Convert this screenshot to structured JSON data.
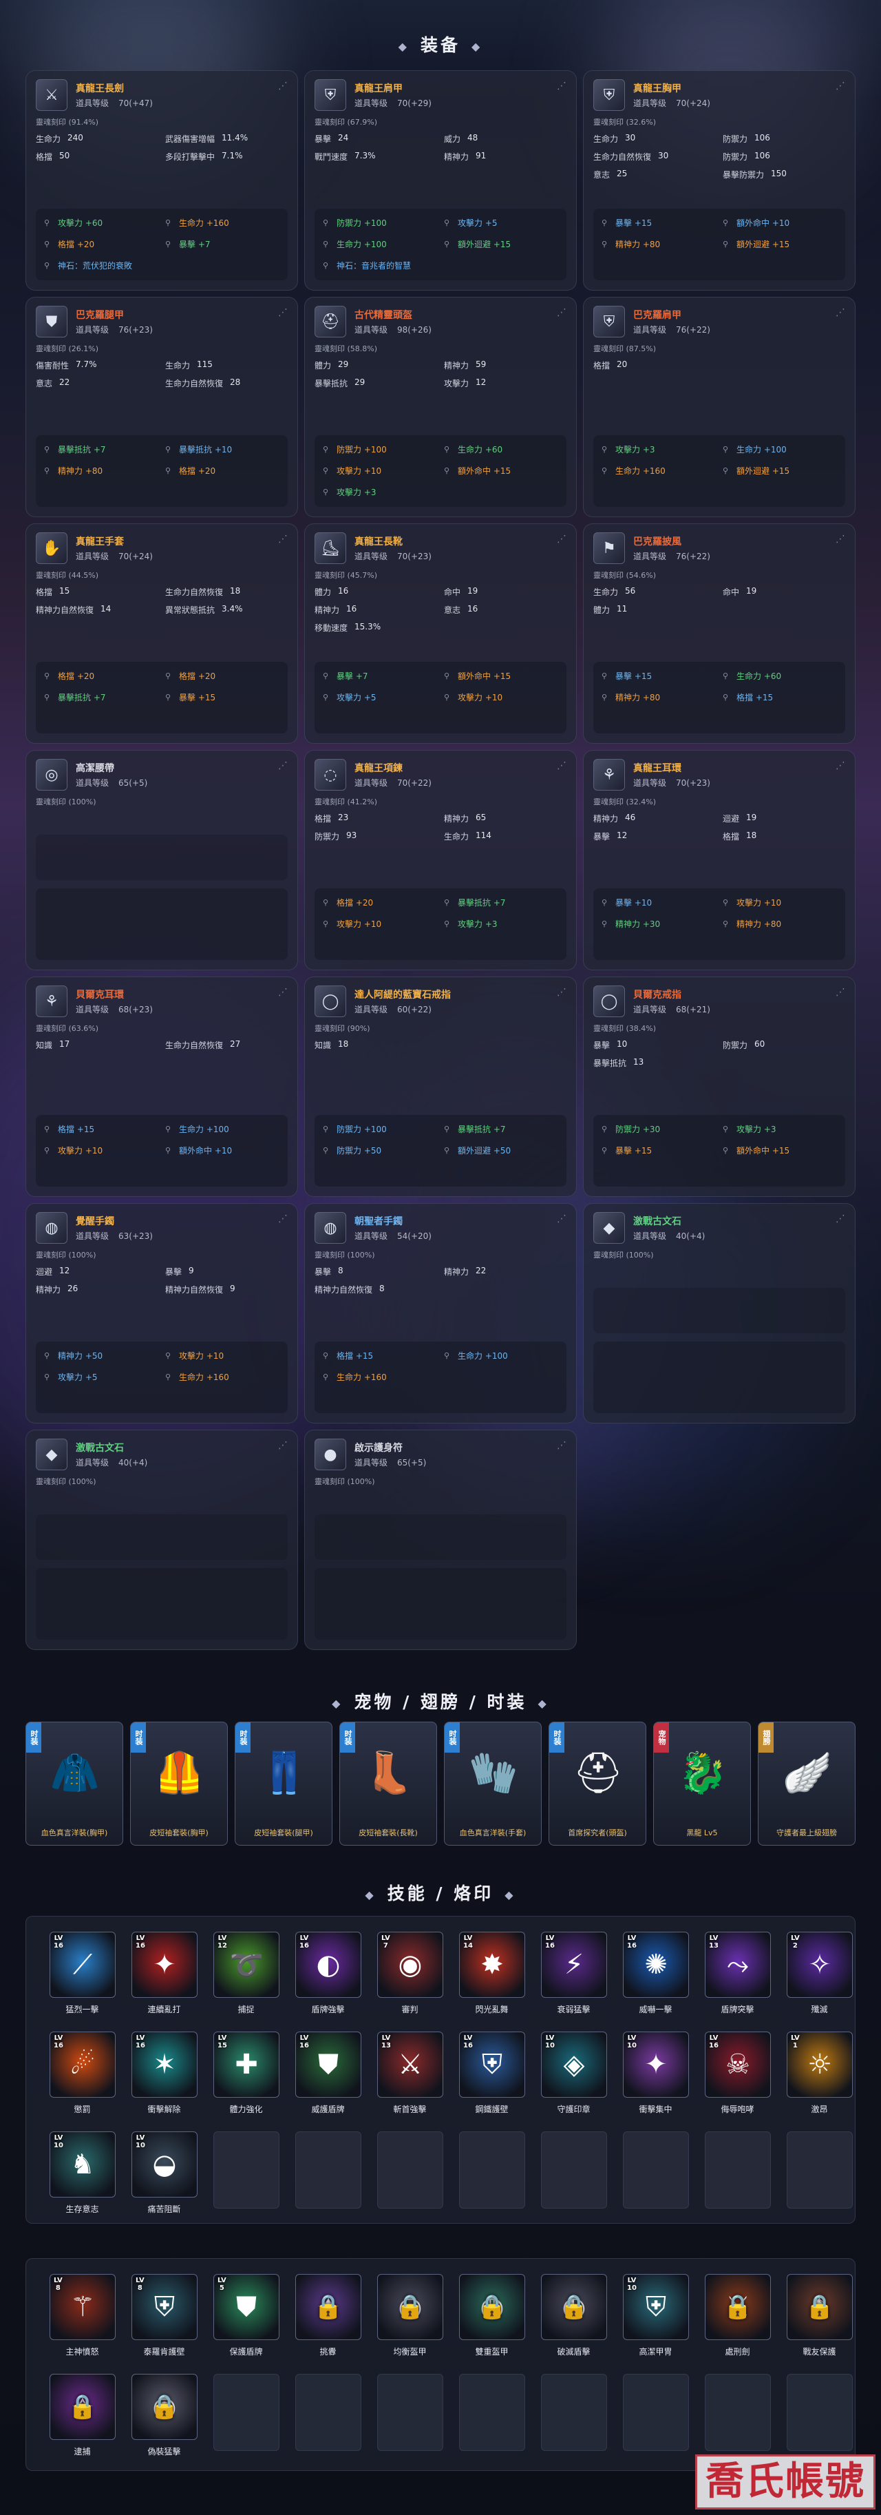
{
  "sections": {
    "equipment": "装备",
    "costume": "宠物 / 翅膀 / 时装",
    "skills": "技能 / 烙印"
  },
  "labels": {
    "item_level": "道具等级",
    "soul_imprint": "靈魂刻印"
  },
  "equipment": [
    {
      "name": "真龍王長劍",
      "name_color": "#f0b04a",
      "icon": "sword-icon",
      "glyph": "⚔",
      "level": "70(+47)",
      "soul": "靈魂刻印 (91.4%)",
      "stats": [
        [
          "生命力",
          "240"
        ],
        [
          "武器傷害增幅",
          "11.4%"
        ],
        [
          "格擋",
          "50"
        ],
        [
          "多段打擊擊中",
          "7.1%"
        ]
      ],
      "mods": [
        [
          "green",
          "攻擊力 +60"
        ],
        [
          "orange",
          "生命力 +160"
        ],
        [
          "orange",
          "格擋 +20"
        ],
        [
          "green",
          "暴擊 +7"
        ],
        [
          "blue",
          "神石：荒伏犯的衰敗"
        ]
      ]
    },
    {
      "name": "真龍王肩甲",
      "name_color": "#f0b04a",
      "icon": "shoulder-armor-icon",
      "glyph": "⛨",
      "level": "70(+29)",
      "soul": "靈魂刻印 (67.9%)",
      "stats": [
        [
          "暴擊",
          "24"
        ],
        [
          "威力",
          "48"
        ],
        [
          "戰鬥速度",
          "7.3%"
        ],
        [
          "精神力",
          "91"
        ]
      ],
      "mods": [
        [
          "green",
          "防禦力 +100"
        ],
        [
          "blue",
          "攻擊力 +5"
        ],
        [
          "green",
          "生命力 +100"
        ],
        [
          "green",
          "額外迴避 +15"
        ],
        [
          "blue",
          "神石：音兆者的智慧"
        ]
      ]
    },
    {
      "name": "真龍王胸甲",
      "name_color": "#f0b04a",
      "icon": "chest-armor-icon",
      "glyph": "⛨",
      "level": "70(+24)",
      "soul": "靈魂刻印 (32.6%)",
      "stats": [
        [
          "生命力",
          "30"
        ],
        [
          "防禦力",
          "106"
        ],
        [
          "生命力自然恢復",
          "30"
        ],
        [
          "防禦力",
          "106"
        ],
        [
          "意志",
          "25"
        ],
        [
          "暴擊防禦力",
          "150"
        ]
      ],
      "mods": [
        [
          "blue",
          "暴擊 +15"
        ],
        [
          "blue",
          "額外命中 +10"
        ],
        [
          "orange",
          "精神力 +80"
        ],
        [
          "orange",
          "額外迴避 +15"
        ]
      ]
    },
    {
      "name": "巴克羅腿甲",
      "name_color": "#e86a3a",
      "icon": "leg-armor-icon",
      "glyph": "⛊",
      "level": "76(+23)",
      "soul": "靈魂刻印 (26.1%)",
      "stats": [
        [
          "傷害耐性",
          "7.7%"
        ],
        [
          "生命力",
          "115"
        ],
        [
          "意志",
          "22"
        ],
        [
          "生命力自然恢復",
          "28"
        ]
      ],
      "mods": [
        [
          "green",
          "暴擊抵抗 +7"
        ],
        [
          "blue",
          "暴擊抵抗 +10"
        ],
        [
          "orange",
          "精神力 +80"
        ],
        [
          "orange",
          "格擋 +20"
        ]
      ]
    },
    {
      "name": "古代精靈頭盔",
      "name_color": "#e86a3a",
      "icon": "helmet-icon",
      "glyph": "⛑",
      "level": "98(+26)",
      "soul": "靈魂刻印 (58.8%)",
      "stats": [
        [
          "體力",
          "29"
        ],
        [
          "精神力",
          "59"
        ],
        [
          "暴擊抵抗",
          "29"
        ],
        [
          "攻擊力",
          "12"
        ]
      ],
      "mods": [
        [
          "orange",
          "防禦力 +100"
        ],
        [
          "green",
          "生命力 +60"
        ],
        [
          "orange",
          "攻擊力 +10"
        ],
        [
          "orange",
          "額外命中 +15"
        ],
        [
          "green",
          "攻擊力 +3"
        ]
      ]
    },
    {
      "name": "巴克羅肩甲",
      "name_color": "#e86a3a",
      "icon": "pauldron-icon",
      "glyph": "⛨",
      "level": "76(+22)",
      "soul": "靈魂刻印 (87.5%)",
      "stats": [
        [
          "格擋",
          "20"
        ]
      ],
      "mods": [
        [
          "green",
          "攻擊力 +3"
        ],
        [
          "blue",
          "生命力 +100"
        ],
        [
          "orange",
          "生命力 +160"
        ],
        [
          "orange",
          "額外迴避 +15"
        ]
      ]
    },
    {
      "name": "真龍王手套",
      "name_color": "#f0b04a",
      "icon": "gloves-icon",
      "glyph": "✋",
      "level": "70(+24)",
      "soul": "靈魂刻印 (44.5%)",
      "stats": [
        [
          "格擋",
          "15"
        ],
        [
          "生命力自然恢復",
          "18"
        ],
        [
          "精神力自然恢復",
          "14"
        ],
        [
          "異常狀態抵抗",
          "3.4%"
        ]
      ],
      "mods": [
        [
          "orange",
          "格擋 +20"
        ],
        [
          "orange",
          "格擋 +20"
        ],
        [
          "green",
          "暴擊抵抗 +7"
        ],
        [
          "orange",
          "暴擊 +15"
        ]
      ]
    },
    {
      "name": "真龍王長靴",
      "name_color": "#f0b04a",
      "icon": "boots-icon",
      "glyph": "⛸",
      "level": "70(+23)",
      "soul": "靈魂刻印 (45.7%)",
      "stats": [
        [
          "體力",
          "16"
        ],
        [
          "命中",
          "19"
        ],
        [
          "精神力",
          "16"
        ],
        [
          "意志",
          "16"
        ],
        [
          "移動速度",
          "15.3%"
        ]
      ],
      "mods": [
        [
          "green",
          "暴擊 +7"
        ],
        [
          "orange",
          "額外命中 +15"
        ],
        [
          "blue",
          "攻擊力 +5"
        ],
        [
          "orange",
          "攻擊力 +10"
        ]
      ]
    },
    {
      "name": "巴克羅披風",
      "name_color": "#e86a3a",
      "icon": "cape-icon",
      "glyph": "⚑",
      "level": "76(+22)",
      "soul": "靈魂刻印 (54.6%)",
      "stats": [
        [
          "生命力",
          "56"
        ],
        [
          "命中",
          "19"
        ],
        [
          "體力",
          "11"
        ]
      ],
      "mods": [
        [
          "blue",
          "暴擊 +15"
        ],
        [
          "green",
          "生命力 +60"
        ],
        [
          "orange",
          "精神力 +80"
        ],
        [
          "blue",
          "格擋 +15"
        ]
      ]
    },
    {
      "name": "高潔腰帶",
      "name_color": "#d6d8e2",
      "icon": "belt-icon",
      "glyph": "◎",
      "level": "65(+5)",
      "soul": "靈魂刻印 (100%)",
      "stats": [],
      "mods": []
    },
    {
      "name": "真龍王項鍊",
      "name_color": "#f0b04a",
      "icon": "necklace-icon",
      "glyph": "◌",
      "level": "70(+22)",
      "soul": "靈魂刻印 (41.2%)",
      "stats": [
        [
          "格擋",
          "23"
        ],
        [
          "精神力",
          "65"
        ],
        [
          "防禦力",
          "93"
        ],
        [
          "生命力",
          "114"
        ]
      ],
      "mods": [
        [
          "orange",
          "格擋 +20"
        ],
        [
          "green",
          "暴擊抵抗 +7"
        ],
        [
          "orange",
          "攻擊力 +10"
        ],
        [
          "green",
          "攻擊力 +3"
        ]
      ]
    },
    {
      "name": "真龍王耳環",
      "name_color": "#f0b04a",
      "icon": "earring-icon",
      "glyph": "⚘",
      "level": "70(+23)",
      "soul": "靈魂刻印 (32.4%)",
      "stats": [
        [
          "精神力",
          "46"
        ],
        [
          "迴避",
          "19"
        ],
        [
          "暴擊",
          "12"
        ],
        [
          "格擋",
          "18"
        ]
      ],
      "mods": [
        [
          "blue",
          "暴擊 +10"
        ],
        [
          "orange",
          "攻擊力 +10"
        ],
        [
          "green",
          "精神力 +30"
        ],
        [
          "orange",
          "精神力 +80"
        ]
      ]
    },
    {
      "name": "貝爾克耳環",
      "name_color": "#e86a3a",
      "icon": "earring-icon",
      "glyph": "⚘",
      "level": "68(+23)",
      "soul": "靈魂刻印 (63.6%)",
      "stats": [
        [
          "知識",
          "17"
        ],
        [
          "生命力自然恢復",
          "27"
        ]
      ],
      "mods": [
        [
          "blue",
          "格擋 +15"
        ],
        [
          "blue",
          "生命力 +100"
        ],
        [
          "orange",
          "攻擊力 +10"
        ],
        [
          "blue",
          "額外命中 +10"
        ]
      ]
    },
    {
      "name": "達人阿緹的藍寶石戒指",
      "name_color": "#f0b04a",
      "icon": "ring-icon",
      "glyph": "◯",
      "level": "60(+22)",
      "soul": "靈魂刻印 (90%)",
      "stats": [
        [
          "知識",
          "18"
        ]
      ],
      "mods": [
        [
          "blue",
          "防禦力 +100"
        ],
        [
          "green",
          "暴擊抵抗 +7"
        ],
        [
          "blue",
          "防禦力 +50"
        ],
        [
          "blue",
          "額外迴避 +50"
        ]
      ]
    },
    {
      "name": "貝爾克戒指",
      "name_color": "#e86a3a",
      "icon": "ring-icon",
      "glyph": "◯",
      "level": "68(+21)",
      "soul": "靈魂刻印 (38.4%)",
      "stats": [
        [
          "暴擊",
          "10"
        ],
        [
          "防禦力",
          "60"
        ],
        [
          "暴擊抵抗",
          "13"
        ]
      ],
      "mods": [
        [
          "green",
          "防禦力 +30"
        ],
        [
          "green",
          "攻擊力 +3"
        ],
        [
          "orange",
          "暴擊 +15"
        ],
        [
          "orange",
          "額外命中 +15"
        ]
      ]
    },
    {
      "name": "覺醒手鐲",
      "name_color": "#f0b04a",
      "icon": "bracelet-icon",
      "glyph": "◍",
      "level": "63(+23)",
      "soul": "靈魂刻印 (100%)",
      "stats": [
        [
          "迴避",
          "12"
        ],
        [
          "暴擊",
          "9"
        ],
        [
          "精神力",
          "26"
        ],
        [
          "精神力自然恢復",
          "9"
        ]
      ],
      "mods": [
        [
          "blue",
          "精神力 +50"
        ],
        [
          "orange",
          "攻擊力 +10"
        ],
        [
          "blue",
          "攻擊力 +5"
        ],
        [
          "orange",
          "生命力 +160"
        ]
      ]
    },
    {
      "name": "朝聖者手鐲",
      "name_color": "#6cb4f0",
      "icon": "bracelet-icon",
      "glyph": "◍",
      "level": "54(+20)",
      "soul": "靈魂刻印 (100%)",
      "stats": [
        [
          "暴擊",
          "8"
        ],
        [
          "精神力",
          "22"
        ],
        [
          "精神力自然恢復",
          "8"
        ]
      ],
      "mods": [
        [
          "blue",
          "格擋 +15"
        ],
        [
          "blue",
          "生命力 +100"
        ],
        [
          "orange",
          "生命力 +160"
        ]
      ]
    },
    {
      "name": "激戰古文石",
      "name_color": "#5fd07f",
      "icon": "rune-stone-icon",
      "glyph": "◆",
      "level": "40(+4)",
      "soul": "靈魂刻印 (100%)",
      "stats": [],
      "mods": []
    },
    {
      "name": "激戰古文石",
      "name_color": "#5fd07f",
      "icon": "rune-stone-icon",
      "glyph": "◆",
      "level": "40(+4)",
      "soul": "靈魂刻印 (100%)",
      "stats": [],
      "mods": []
    },
    {
      "name": "啟示護身符",
      "name_color": "#d6d8e2",
      "icon": "amulet-icon",
      "glyph": "●",
      "level": "65(+5)",
      "soul": "靈魂刻印 (100%)",
      "stats": [],
      "mods": []
    }
  ],
  "costumes": [
    {
      "badge": "时装",
      "badge_color": "#2e7fd0",
      "icon": "red-hood-icon",
      "glyph": "🧥",
      "color": "#c03030",
      "caption": "血色真言洋裝(胸甲)"
    },
    {
      "badge": "时装",
      "badge_color": "#2e7fd0",
      "icon": "chest-suit-icon",
      "glyph": "🦺",
      "color": "#cfd3dc",
      "caption": "皮短袖套裝(胸甲)"
    },
    {
      "badge": "时装",
      "badge_color": "#2e7fd0",
      "icon": "pants-icon",
      "glyph": "👖",
      "color": "#30333c",
      "caption": "皮短袖套裝(腿甲)"
    },
    {
      "badge": "时装",
      "badge_color": "#2e7fd0",
      "icon": "boots-icon",
      "glyph": "👢",
      "color": "#24262e",
      "caption": "皮短袖套裝(長靴)"
    },
    {
      "badge": "时装",
      "badge_color": "#2e7fd0",
      "icon": "glove-icon",
      "glyph": "🧤",
      "color": "#e0b040",
      "caption": "血色真言洋裝(手套)"
    },
    {
      "badge": "时装",
      "badge_color": "#2e7fd0",
      "icon": "mask-icon",
      "glyph": "⛑",
      "color": "#f4f4f4",
      "caption": "首席探究者(頭盔)"
    },
    {
      "badge": "宠物",
      "badge_color": "#c03040",
      "icon": "dragon-pet-icon",
      "glyph": "🐉",
      "color": "#3a4052",
      "caption": "黑龍 Lv5"
    },
    {
      "badge": "翅膀",
      "badge_color": "#c08a30",
      "icon": "wings-icon",
      "glyph": "🪽",
      "color": "#8a3ad0",
      "caption": "守護者最上級翅膀"
    }
  ],
  "skills": [
    {
      "name": "猛烈一擊",
      "lv": "16",
      "icon": "slash-icon",
      "glyph": "⟋",
      "color": "#2a7fc8"
    },
    {
      "name": "連續亂打",
      "lv": "16",
      "icon": "multi-strike-icon",
      "glyph": "✦",
      "color": "#b02020"
    },
    {
      "name": "捕捉",
      "lv": "12",
      "icon": "capture-icon",
      "glyph": "➰",
      "color": "#4a9a2a"
    },
    {
      "name": "盾牌強擊",
      "lv": "16",
      "icon": "shield-bash-icon",
      "glyph": "◐",
      "color": "#6a2aa0"
    },
    {
      "name": "審判",
      "lv": "7",
      "icon": "judgement-icon",
      "glyph": "◉",
      "color": "#8a2a2a"
    },
    {
      "name": "閃光亂舞",
      "lv": "14",
      "icon": "flash-dance-icon",
      "glyph": "✸",
      "color": "#c03020"
    },
    {
      "name": "衰弱猛擊",
      "lv": "16",
      "icon": "weakening-strike-icon",
      "glyph": "⚡",
      "color": "#5a2a8a"
    },
    {
      "name": "威嚇一擊",
      "lv": "16",
      "icon": "intimidate-icon",
      "glyph": "✺",
      "color": "#1a5ab0"
    },
    {
      "name": "盾牌突擊",
      "lv": "13",
      "icon": "shield-charge-icon",
      "glyph": "⤳",
      "color": "#6a30b0"
    },
    {
      "name": "殲滅",
      "lv": "2",
      "icon": "annihilate-icon",
      "glyph": "✧",
      "color": "#5a2aa0"
    },
    {
      "name": "懲罰",
      "lv": "16",
      "icon": "punish-icon",
      "glyph": "☄",
      "color": "#d04a10"
    },
    {
      "name": "衝擊解除",
      "lv": "16",
      "icon": "impact-release-icon",
      "glyph": "✶",
      "color": "#1a8a8a"
    },
    {
      "name": "體力強化",
      "lv": "15",
      "icon": "vitality-icon",
      "glyph": "✚",
      "color": "#2a8a6a"
    },
    {
      "name": "威護盾牌",
      "lv": "16",
      "icon": "guard-shield-icon",
      "glyph": "⛊",
      "color": "#2a6a3a"
    },
    {
      "name": "斬首強擊",
      "lv": "13",
      "icon": "behead-icon",
      "glyph": "⚔",
      "color": "#8a2a2a"
    },
    {
      "name": "鋼鐵護壁",
      "lv": "16",
      "icon": "iron-wall-icon",
      "glyph": "⛨",
      "color": "#2a5a9a"
    },
    {
      "name": "守護印章",
      "lv": "10",
      "icon": "guard-seal-icon",
      "glyph": "◈",
      "color": "#1a6a7a"
    },
    {
      "name": "衝擊集中",
      "lv": "10",
      "icon": "focus-strike-icon",
      "glyph": "✦",
      "color": "#7a3aa0"
    },
    {
      "name": "侮辱咆哮",
      "lv": "16",
      "icon": "taunt-icon",
      "glyph": "☠",
      "color": "#8a1a2a"
    },
    {
      "name": "激昂",
      "lv": "1",
      "icon": "exalt-icon",
      "glyph": "☼",
      "color": "#c07a10"
    },
    {
      "name": "生存意志",
      "lv": "10",
      "icon": "survival-icon",
      "glyph": "♞",
      "color": "#2a6a6a"
    },
    {
      "name": "痛苦阻斷",
      "lv": "10",
      "icon": "pain-block-icon",
      "glyph": "◒",
      "color": "#3a4a5a"
    }
  ],
  "stigmas": [
    {
      "name": "主神憤怒",
      "lv": "8",
      "icon": "god-wrath-icon",
      "glyph": "⚚",
      "color": "#8a2a1a",
      "locked": false
    },
    {
      "name": "泰羅肯護壁",
      "lv": "8",
      "icon": "protective-wall-icon",
      "glyph": "⛨",
      "color": "#2a5a6a",
      "locked": false
    },
    {
      "name": "保護盾牌",
      "lv": "5",
      "icon": "protect-shield-icon",
      "glyph": "⛊",
      "color": "#2a8a5a",
      "locked": false
    },
    {
      "name": "挑釁",
      "lv": "",
      "icon": "provoke-icon",
      "glyph": "✦",
      "color": "#5a3a8a",
      "locked": true
    },
    {
      "name": "均衡盔甲",
      "lv": "",
      "icon": "balance-armor-icon",
      "glyph": "◎",
      "color": "#4a4a5a",
      "locked": true
    },
    {
      "name": "雙重盔甲",
      "lv": "",
      "icon": "double-armor-icon",
      "glyph": "◍",
      "color": "#2a6a5a",
      "locked": true
    },
    {
      "name": "破滅盾擊",
      "lv": "",
      "icon": "ruin-shield-icon",
      "glyph": "◐",
      "color": "#4a4a5a",
      "locked": true
    },
    {
      "name": "高潔甲冑",
      "lv": "10",
      "icon": "noble-armor-icon",
      "glyph": "⛨",
      "color": "#2a6a7a",
      "locked": false
    },
    {
      "name": "處刑劍",
      "lv": "",
      "icon": "execute-sword-icon",
      "glyph": "⚔",
      "color": "#8a3a1a",
      "locked": true
    },
    {
      "name": "戰友保護",
      "lv": "",
      "icon": "ally-protect-icon",
      "glyph": "♞",
      "color": "#6a3a2a",
      "locked": true
    },
    {
      "name": "逮捕",
      "lv": "",
      "icon": "arrest-icon",
      "glyph": "✧",
      "color": "#6a2a8a",
      "locked": true
    },
    {
      "name": "偽裝猛擊",
      "lv": "",
      "icon": "disguise-strike-icon",
      "glyph": "◉",
      "color": "#5a5a6a",
      "locked": true
    }
  ],
  "watermark": "喬氏帳號"
}
